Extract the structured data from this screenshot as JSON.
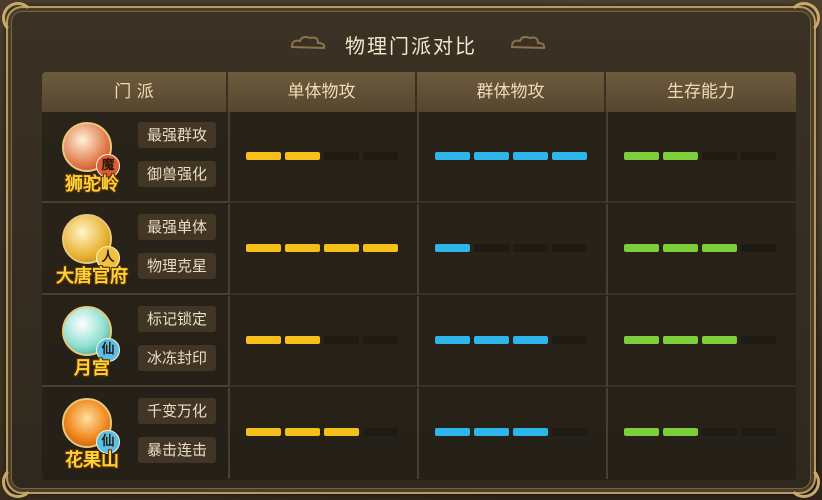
{
  "title": "物理门派对比",
  "headers": [
    "门 派",
    "单体物攻",
    "群体物攻",
    "生存能力"
  ],
  "colors": {
    "single": "#f5c01a",
    "group": "#2db6ea",
    "survival": "#7ccf3a"
  },
  "rows": [
    {
      "name": "狮驼岭",
      "badge": "魔",
      "icon": "lion-sect-icon",
      "tags": [
        "最强群攻",
        "御兽强化"
      ],
      "single": 2,
      "group": 4,
      "survival": 2
    },
    {
      "name": "大唐官府",
      "badge": "人",
      "icon": "tang-sect-icon",
      "tags": [
        "最强单体",
        "物理克星"
      ],
      "single": 4,
      "group": 1,
      "survival": 3
    },
    {
      "name": "月宫",
      "badge": "仙",
      "icon": "moon-palace-icon",
      "tags": [
        "标记锁定",
        "冰冻封印"
      ],
      "single": 2,
      "group": 3,
      "survival": 3
    },
    {
      "name": "花果山",
      "badge": "仙",
      "icon": "flower-mountain-icon",
      "tags": [
        "千变万化",
        "暴击连击"
      ],
      "single": 3,
      "group": 3,
      "survival": 2
    }
  ]
}
